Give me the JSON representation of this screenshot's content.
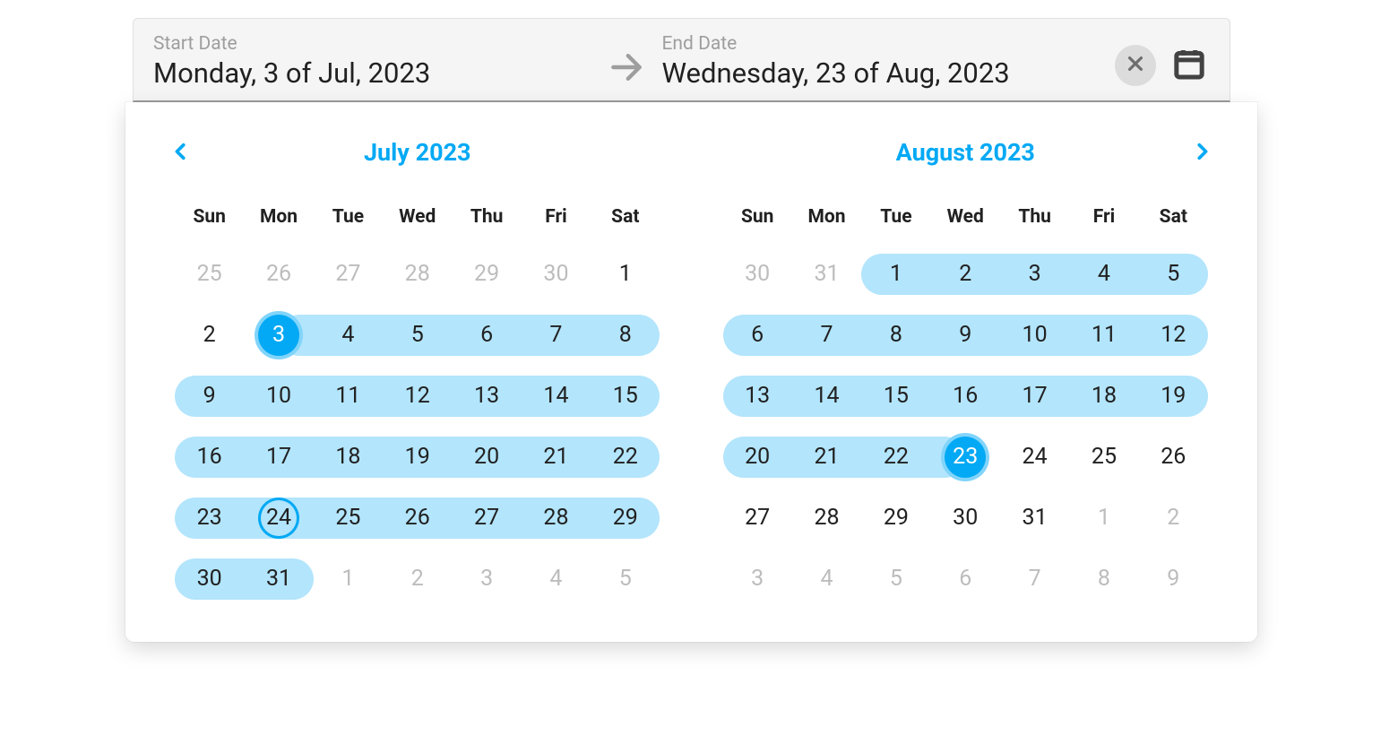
{
  "header": {
    "start_label": "Start Date",
    "start_value": "Monday, 3 of Jul, 2023",
    "end_label": "End Date",
    "end_value": "Wednesday, 23 of Aug, 2023"
  },
  "dow": [
    "Sun",
    "Mon",
    "Tue",
    "Wed",
    "Thu",
    "Fri",
    "Sat"
  ],
  "months": [
    {
      "title": "July 2023",
      "weeks": [
        [
          {
            "n": 25,
            "out": true
          },
          {
            "n": 26,
            "out": true
          },
          {
            "n": 27,
            "out": true
          },
          {
            "n": 28,
            "out": true
          },
          {
            "n": 29,
            "out": true
          },
          {
            "n": 30,
            "out": true
          },
          {
            "n": 1
          }
        ],
        [
          {
            "n": 2
          },
          {
            "n": 3,
            "in": true,
            "start": true,
            "endpoint": true,
            "capL": true
          },
          {
            "n": 4,
            "in": true
          },
          {
            "n": 5,
            "in": true
          },
          {
            "n": 6,
            "in": true
          },
          {
            "n": 7,
            "in": true
          },
          {
            "n": 8,
            "in": true,
            "capR": true
          }
        ],
        [
          {
            "n": 9,
            "in": true,
            "capL": true
          },
          {
            "n": 10,
            "in": true
          },
          {
            "n": 11,
            "in": true
          },
          {
            "n": 12,
            "in": true
          },
          {
            "n": 13,
            "in": true
          },
          {
            "n": 14,
            "in": true
          },
          {
            "n": 15,
            "in": true,
            "capR": true
          }
        ],
        [
          {
            "n": 16,
            "in": true,
            "capL": true
          },
          {
            "n": 17,
            "in": true
          },
          {
            "n": 18,
            "in": true
          },
          {
            "n": 19,
            "in": true
          },
          {
            "n": 20,
            "in": true
          },
          {
            "n": 21,
            "in": true
          },
          {
            "n": 22,
            "in": true,
            "capR": true
          }
        ],
        [
          {
            "n": 23,
            "in": true,
            "capL": true
          },
          {
            "n": 24,
            "in": true,
            "today": true
          },
          {
            "n": 25,
            "in": true
          },
          {
            "n": 26,
            "in": true
          },
          {
            "n": 27,
            "in": true
          },
          {
            "n": 28,
            "in": true
          },
          {
            "n": 29,
            "in": true,
            "capR": true
          }
        ],
        [
          {
            "n": 30,
            "in": true,
            "capL": true
          },
          {
            "n": 31,
            "in": true,
            "capR": true
          },
          {
            "n": 1,
            "out": true
          },
          {
            "n": 2,
            "out": true
          },
          {
            "n": 3,
            "out": true
          },
          {
            "n": 4,
            "out": true
          },
          {
            "n": 5,
            "out": true
          }
        ]
      ]
    },
    {
      "title": "August 2023",
      "weeks": [
        [
          {
            "n": 30,
            "out": true
          },
          {
            "n": 31,
            "out": true
          },
          {
            "n": 1,
            "in": true,
            "capL": true
          },
          {
            "n": 2,
            "in": true
          },
          {
            "n": 3,
            "in": true
          },
          {
            "n": 4,
            "in": true
          },
          {
            "n": 5,
            "in": true,
            "capR": true
          }
        ],
        [
          {
            "n": 6,
            "in": true,
            "capL": true
          },
          {
            "n": 7,
            "in": true
          },
          {
            "n": 8,
            "in": true
          },
          {
            "n": 9,
            "in": true
          },
          {
            "n": 10,
            "in": true
          },
          {
            "n": 11,
            "in": true
          },
          {
            "n": 12,
            "in": true,
            "capR": true
          }
        ],
        [
          {
            "n": 13,
            "in": true,
            "capL": true
          },
          {
            "n": 14,
            "in": true
          },
          {
            "n": 15,
            "in": true
          },
          {
            "n": 16,
            "in": true
          },
          {
            "n": 17,
            "in": true
          },
          {
            "n": 18,
            "in": true
          },
          {
            "n": 19,
            "in": true,
            "capR": true
          }
        ],
        [
          {
            "n": 20,
            "in": true,
            "capL": true
          },
          {
            "n": 21,
            "in": true
          },
          {
            "n": 22,
            "in": true
          },
          {
            "n": 23,
            "in": true,
            "end": true,
            "endpoint": true,
            "capR": true
          },
          {
            "n": 24
          },
          {
            "n": 25
          },
          {
            "n": 26
          }
        ],
        [
          {
            "n": 27
          },
          {
            "n": 28
          },
          {
            "n": 29
          },
          {
            "n": 30
          },
          {
            "n": 31
          },
          {
            "n": 1,
            "out": true
          },
          {
            "n": 2,
            "out": true
          }
        ],
        [
          {
            "n": 3,
            "out": true
          },
          {
            "n": 4,
            "out": true
          },
          {
            "n": 5,
            "out": true
          },
          {
            "n": 6,
            "out": true
          },
          {
            "n": 7,
            "out": true
          },
          {
            "n": 8,
            "out": true
          },
          {
            "n": 9,
            "out": true
          }
        ]
      ]
    }
  ]
}
